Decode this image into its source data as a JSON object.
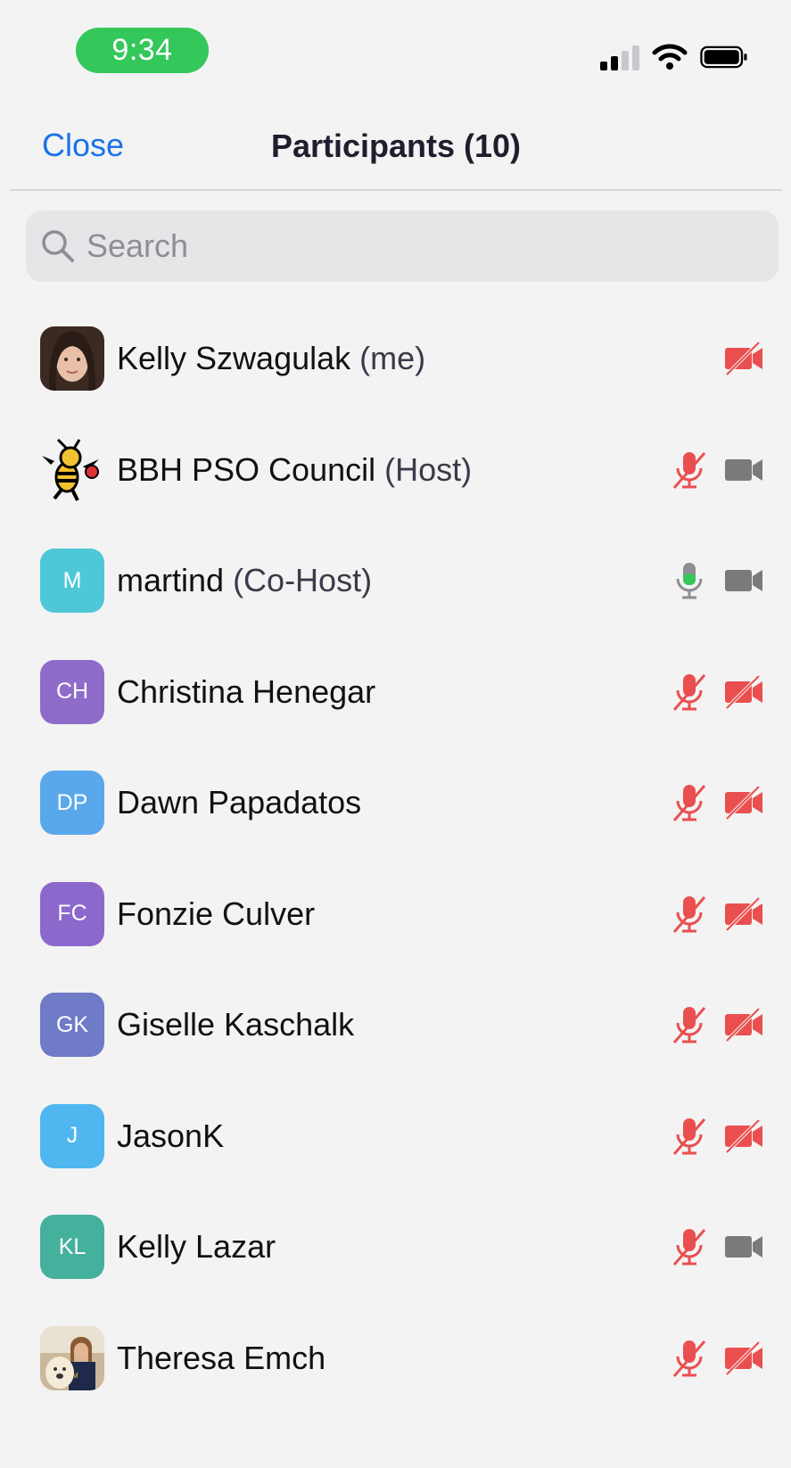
{
  "status_bar": {
    "time": "9:34"
  },
  "header": {
    "close_label": "Close",
    "title": "Participants (10)"
  },
  "search": {
    "placeholder": "Search"
  },
  "colors": {
    "accent": "#1a73e8",
    "muted": "#ea4f4f",
    "unmuted": "#34c759",
    "video_on": "#7a7a7a"
  },
  "participants": [
    {
      "name": "Kelly Szwagulak",
      "role": "(me)",
      "avatar": "photo-woman",
      "mic": "none",
      "video": "off"
    },
    {
      "name": "BBH PSO Council",
      "role": "(Host)",
      "avatar": "hornet-mascot",
      "mic": "muted",
      "video": "on"
    },
    {
      "name": "martind",
      "role": "(Co-Host)",
      "avatar": "M",
      "avatar_color": "#4ec8d8",
      "mic": "on",
      "video": "on"
    },
    {
      "name": "Christina Henegar",
      "role": "",
      "avatar": "CH",
      "avatar_color": "#8f6cc9",
      "mic": "muted",
      "video": "off"
    },
    {
      "name": "Dawn Papadatos",
      "role": "",
      "avatar": "DP",
      "avatar_color": "#5aa8ec",
      "mic": "muted",
      "video": "off"
    },
    {
      "name": "Fonzie Culver",
      "role": "",
      "avatar": "FC",
      "avatar_color": "#8c68cd",
      "mic": "muted",
      "video": "off"
    },
    {
      "name": "Giselle Kaschalk",
      "role": "",
      "avatar": "GK",
      "avatar_color": "#6f7bc6",
      "mic": "muted",
      "video": "off"
    },
    {
      "name": "JasonK",
      "role": "",
      "avatar": "J",
      "avatar_color": "#4fb6f0",
      "mic": "muted",
      "video": "off"
    },
    {
      "name": "Kelly Lazar",
      "role": "",
      "avatar": "KL",
      "avatar_color": "#45b09c",
      "mic": "muted",
      "video": "on"
    },
    {
      "name": "Theresa Emch",
      "role": "",
      "avatar": "photo-woman-dog",
      "mic": "muted",
      "video": "off"
    }
  ]
}
